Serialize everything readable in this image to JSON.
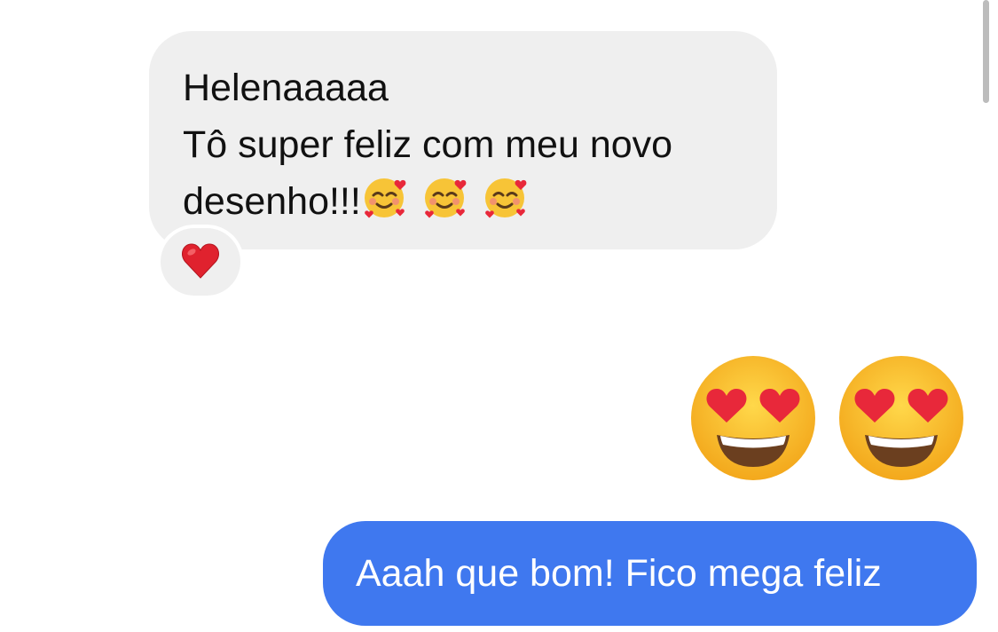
{
  "conversation": {
    "incoming": {
      "line1": "Helenaaaaa",
      "line2": "Tô super feliz com meu novo",
      "line3": "desenho!!!",
      "trailing_emojis": [
        "smiling-face-with-hearts",
        "smiling-face-with-hearts",
        "smiling-face-with-hearts"
      ],
      "reaction": "red-heart",
      "bubble_color": "#efefef"
    },
    "outgoing_emojis": [
      "heart-eyes",
      "heart-eyes"
    ],
    "outgoing": {
      "text": "Aaah que bom! Fico mega feliz",
      "bubble_color": "#3f78ef"
    }
  }
}
